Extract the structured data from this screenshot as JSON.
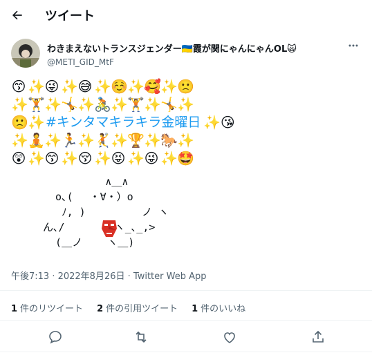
{
  "header": {
    "title": "ツイート"
  },
  "author": {
    "display_name": "わきまえないトランスジェンダー🇺🇦霞が関にゃんにゃんOL🙀",
    "handle": "@METI_GID_MtF"
  },
  "tweet": {
    "emoji_rows": [
      [
        "😙",
        "✨",
        "😜",
        "✨",
        "😅",
        "✨",
        "☺️",
        "✨",
        "🥰",
        "✨",
        "🙁"
      ],
      [
        "✨",
        "🏋️",
        "✨",
        "🤸",
        "✨",
        "🚴",
        "✨",
        "🏋️",
        "✨",
        "🤸",
        "✨"
      ],
      [
        "🙁",
        "✨",
        "✨",
        "😘"
      ],
      [
        "✨",
        "🧘",
        "✨",
        "🏃",
        "✨",
        "🤾",
        "✨",
        "🏆",
        "✨",
        "🐎",
        "✨"
      ],
      [
        "😲",
        "✨",
        "😙",
        "✨",
        "😚",
        "✨",
        "😝",
        "✨",
        "😜",
        "✨",
        "🤩"
      ]
    ],
    "hashtag": "#キンタマキラキラ金曜日",
    "ascii_art": "          ∧＿∧\n  o､(　 ・∀・）o\n   ﾉ, )         ノ ヽ\nん､/        ヽ_､_,>\n  (＿ノ    ヽ＿)",
    "timestamp": "午後7:13 · 2022年8月26日",
    "source": "Twitter Web App"
  },
  "stats": [
    {
      "count": "1",
      "label": "件のリツイート"
    },
    {
      "count": "2",
      "label": "件の引用ツイート"
    },
    {
      "count": "1",
      "label": "件のいいね"
    }
  ],
  "colors": {
    "link": "#1d9bf0",
    "muted": "#536471",
    "divider": "#eff3f4"
  }
}
